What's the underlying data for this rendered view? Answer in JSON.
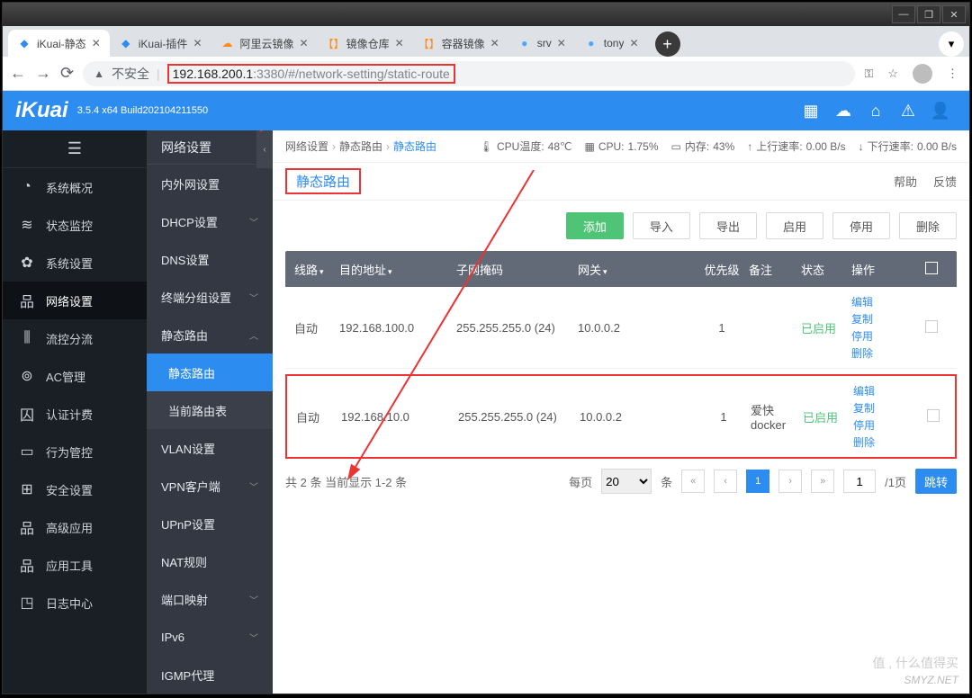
{
  "window": {
    "min": "—",
    "max": "❐",
    "close": "✕"
  },
  "browser": {
    "tabs": [
      {
        "favicon": "◆",
        "favcolor": "#2d8cf0",
        "title": "iKuai-静态",
        "active": true
      },
      {
        "favicon": "◆",
        "favcolor": "#2d8cf0",
        "title": "iKuai-插件"
      },
      {
        "favicon": "☁",
        "favcolor": "#ff8c1a",
        "title": "阿里云镜像"
      },
      {
        "favicon": "【】",
        "favcolor": "#ff8c1a",
        "title": "镜像仓库"
      },
      {
        "favicon": "【】",
        "favcolor": "#ff8c1a",
        "title": "容器镜像"
      },
      {
        "favicon": "●",
        "favcolor": "#4aa8ff",
        "title": "srv"
      },
      {
        "favicon": "●",
        "favcolor": "#4aa8ff",
        "title": "tony"
      }
    ],
    "insecure": "不安全",
    "url_host": "192.168.200.1",
    "url_rest": ":3380/#/network-setting/static-route"
  },
  "header": {
    "logo": "iKuai",
    "build": "3.5.4 x64 Build202104211550"
  },
  "sidebar1": [
    {
      "icon": "◔",
      "label": "系统概况"
    },
    {
      "icon": "≋",
      "label": "状态监控"
    },
    {
      "icon": "✿",
      "label": "系统设置"
    },
    {
      "icon": "品",
      "label": "网络设置",
      "active": true
    },
    {
      "icon": "⫼",
      "label": "流控分流"
    },
    {
      "icon": "⊚",
      "label": "AC管理"
    },
    {
      "icon": "囚",
      "label": "认证计费"
    },
    {
      "icon": "▭",
      "label": "行为管控"
    },
    {
      "icon": "⊞",
      "label": "安全设置"
    },
    {
      "icon": "品",
      "label": "高级应用"
    },
    {
      "icon": "品",
      "label": "应用工具"
    },
    {
      "icon": "◳",
      "label": "日志中心"
    }
  ],
  "sidebar2": {
    "title": "网络设置",
    "items": [
      {
        "label": "内外网设置",
        "chev": ""
      },
      {
        "label": "DHCP设置",
        "chev": "﹀"
      },
      {
        "label": "DNS设置",
        "chev": ""
      },
      {
        "label": "终端分组设置",
        "chev": "﹀"
      },
      {
        "label": "静态路由",
        "chev": "︿",
        "expanded": true,
        "subs": [
          {
            "label": "静态路由",
            "active": true
          },
          {
            "label": "当前路由表"
          }
        ]
      },
      {
        "label": "VLAN设置",
        "chev": ""
      },
      {
        "label": "VPN客户端",
        "chev": "﹀"
      },
      {
        "label": "UPnP设置",
        "chev": ""
      },
      {
        "label": "NAT规则",
        "chev": ""
      },
      {
        "label": "端口映射",
        "chev": "﹀"
      },
      {
        "label": "IPv6",
        "chev": "﹀"
      },
      {
        "label": "IGMP代理",
        "chev": ""
      }
    ]
  },
  "breadcrumb": [
    "网络设置",
    "静态路由",
    "静态路由"
  ],
  "stats": {
    "cpu_temp_label": "CPU温度:",
    "cpu_temp": "48℃",
    "cpu_label": "CPU:",
    "cpu": "1.75%",
    "mem_label": "内存:",
    "mem": "43%",
    "up_label": "上行速率:",
    "up": "0.00 B/s",
    "down_label": "下行速率:",
    "down": "0.00 B/s"
  },
  "page_tab": "静态路由",
  "help": "帮助",
  "feedback": "反馈",
  "buttons": {
    "add": "添加",
    "import": "导入",
    "export": "导出",
    "enable": "启用",
    "disable": "停用",
    "delete": "删除"
  },
  "columns": {
    "line": "线路",
    "dest": "目的地址",
    "mask": "子网掩码",
    "gw": "网关",
    "prio": "优先级",
    "note": "备注",
    "status": "状态",
    "ops": "操作"
  },
  "rows": [
    {
      "line": "自动",
      "dest": "192.168.100.0",
      "mask": "255.255.255.0 (24)",
      "gw": "10.0.0.2",
      "prio": "1",
      "note": "",
      "status": "已启用"
    },
    {
      "line": "自动",
      "dest": "192.168.10.0",
      "mask": "255.255.255.0 (24)",
      "gw": "10.0.0.2",
      "prio": "1",
      "note": "爱快docker",
      "status": "已启用",
      "hl": true
    }
  ],
  "ops": {
    "edit": "编辑",
    "copy": "复制",
    "disable": "停用",
    "delete": "删除"
  },
  "pager": {
    "summary": "共 2 条 当前显示 1-2 条",
    "perpage_label": "每页",
    "perpage": "20",
    "unit": "条",
    "page": "1",
    "page_input": "1",
    "total_suffix": "/1页",
    "jump": "跳转"
  },
  "watermark": "SMYZ.NET",
  "watermark2": "值 , 什么值得买"
}
